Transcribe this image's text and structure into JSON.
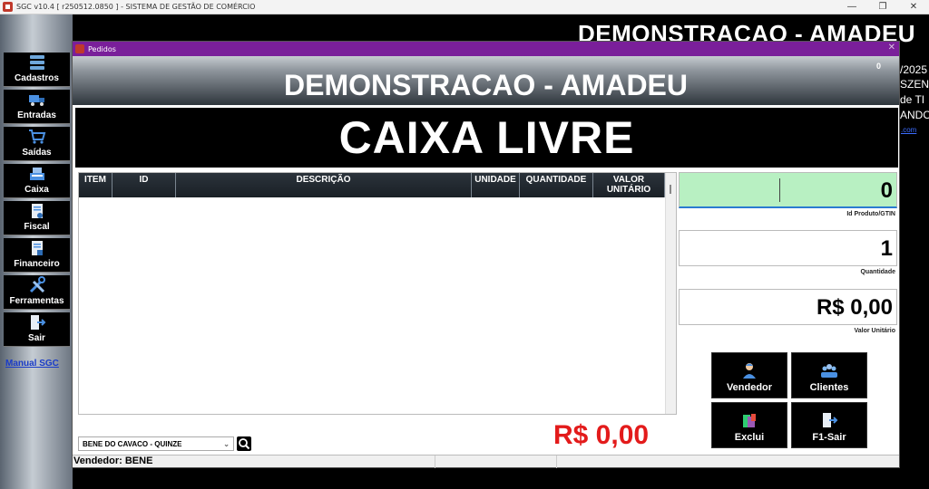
{
  "app": {
    "title": "SGC v10.4 [ r250512.0850 ] - SISTEMA DE GESTÃO DE COMÉRCIO",
    "controls": [
      "—",
      "❐",
      "✕"
    ]
  },
  "sidebar": {
    "items": [
      {
        "label": "Cadastros",
        "icon": "database-icon"
      },
      {
        "label": "Entradas",
        "icon": "truck-icon"
      },
      {
        "label": "Saídas",
        "icon": "cart-icon"
      },
      {
        "label": "Caixa",
        "icon": "cash-register-icon"
      },
      {
        "label": "Fiscal",
        "icon": "fiscal-document-icon"
      },
      {
        "label": "Financeiro",
        "icon": "finance-document-icon"
      },
      {
        "label": "Ferramentas",
        "icon": "tools-icon"
      },
      {
        "label": "Sair",
        "icon": "exit-door-icon"
      }
    ],
    "manual_link": "Manual SGC"
  },
  "background": {
    "title": "DEMONSTRACAO - AMADEU",
    "right_fragments": [
      "/2025",
      "SZEN",
      "de TI",
      "ANDO"
    ],
    "right_link": ".com"
  },
  "modal": {
    "title": "Pedidos",
    "close": "✕",
    "banner_title": "DEMONSTRACAO - AMADEU",
    "banner_counter": "0",
    "status": "CAIXA LIVRE"
  },
  "table": {
    "columns": [
      "ITEM",
      "ID",
      "DESCRIÇÃO",
      "UNIDADE",
      "QUANTIDADE",
      "VALOR UNITÁRIO"
    ],
    "rows": []
  },
  "fields": {
    "product_id": {
      "value": "0",
      "label": "Id Produto/GTIN"
    },
    "quantity": {
      "value": "1",
      "label": "Quantidade"
    },
    "unit_price": {
      "value": "R$ 0,00",
      "label": "Valor Unitário"
    }
  },
  "actions": {
    "vendedor": "Vendedor",
    "clientes": "Clientes",
    "exclui": "Exclui",
    "sair": "F1-Sair"
  },
  "bottom": {
    "selected_vendor": "BENE DO CAVACO - QUINZE",
    "total": "R$ 0,00",
    "statusbar_vendor": "Vendedor: BENE"
  },
  "colors": {
    "modal_titlebar": "#7a1f9a",
    "total_red": "#e31b1b",
    "product_field_green": "#b8f0c2",
    "link_blue": "#1a3cc8"
  }
}
